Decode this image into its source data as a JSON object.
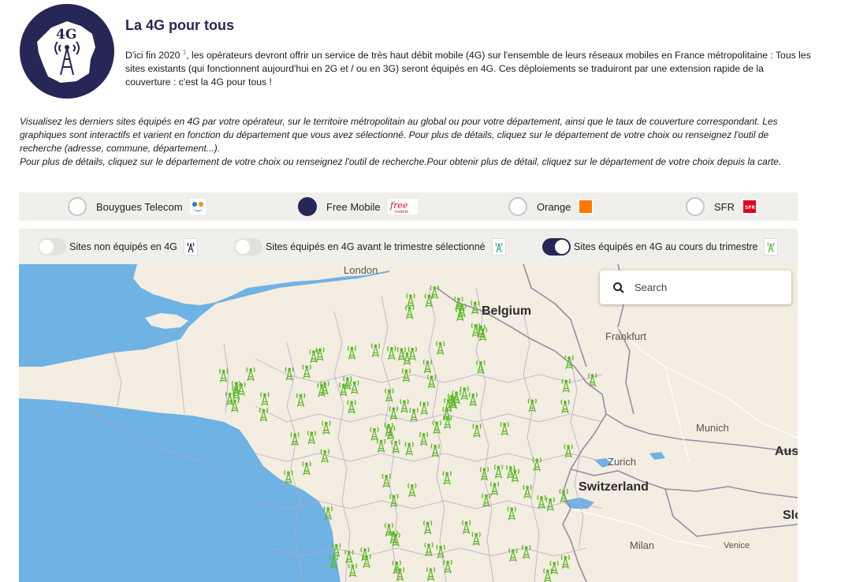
{
  "header": {
    "title": "La 4G pour tous",
    "logo_text": "4G",
    "intro_before": "D'ici fin 2020",
    "intro_sup": "1",
    "intro_after": ", les opérateurs devront offrir un service de très haut débit mobile (4G) sur l'ensemble de leurs réseaux mobiles en France métropolitaine : Tous les sites existants (qui fonctionnent aujourd'hui en 2G et / ou en 3G) seront équipés en 4G. Ces déploiements se traduiront par une extension rapide de la couverture : c'est la 4G pour tous !"
  },
  "description": {
    "line1": "Visualisez les derniers sites équipés en 4G par votre opérateur, sur le territoire métropolitain au global ou pour votre département, ainsi que le taux de couverture correspondant. Les graphiques sont interactifs et varient en fonction du département que vous avez sélectionné. Pour plus de détails, cliquez sur le département de votre choix ou renseignez l'outil de recherche (adresse, commune, département...).",
    "line2": "Pour plus de détails, cliquez sur le département de votre choix ou renseignez l'outil de recherche.Pour obtenir plus de détail, cliquez sur le département de votre choix depuis la carte."
  },
  "operators": [
    {
      "label": "Bouygues Telecom",
      "selected": false,
      "icon": "bouygues-logo-icon"
    },
    {
      "label": "Free Mobile",
      "selected": true,
      "icon": "free-logo-icon"
    },
    {
      "label": "Orange",
      "selected": false,
      "icon": "orange-logo-icon"
    },
    {
      "label": "SFR",
      "selected": false,
      "icon": "sfr-logo-icon"
    }
  ],
  "toggles": [
    {
      "label": "Sites non équipés en 4G",
      "on": false,
      "icon": "antenna-blue-icon"
    },
    {
      "label": "Sites équipés en 4G avant le trimestre sélectionné",
      "on": false,
      "icon": "antenna-teal-icon"
    },
    {
      "label": "Sites équipés en 4G au cours du trimestre",
      "on": true,
      "icon": "antenna-green-icon"
    }
  ],
  "search": {
    "placeholder": "Search"
  },
  "map": {
    "labels": {
      "london": "London",
      "belgium": "Belgium",
      "frankfurt": "Frankfurt",
      "munich": "Munich",
      "zurich": "Zurich",
      "switzerland": "Switzerland",
      "austria": "Aus",
      "slovenia": "Slo",
      "milan": "Milan",
      "venice": "Venice"
    },
    "antenna_count": 118
  },
  "colors": {
    "brand": "#262657",
    "sea": "#6fb2e4",
    "land": "#f4ede1",
    "antenna": "#5cb82a",
    "panel": "#f1efec"
  }
}
